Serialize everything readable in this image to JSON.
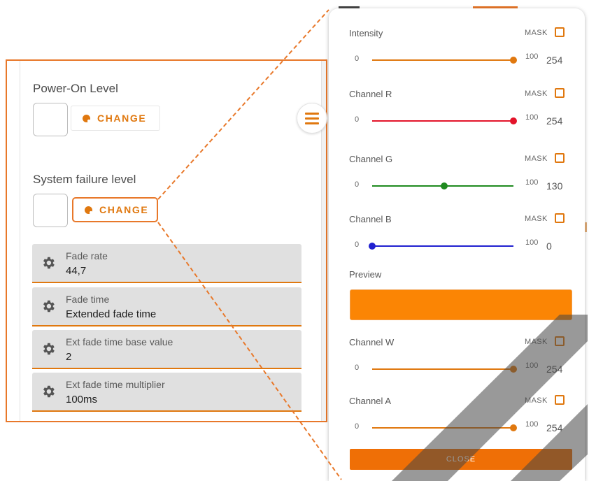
{
  "left_panel": {
    "power_on": {
      "label": "Power-On Level",
      "button": "CHANGE"
    },
    "system_failure": {
      "label": "System failure level",
      "button": "CHANGE"
    },
    "settings": [
      {
        "title": "Fade rate",
        "value": "44,7"
      },
      {
        "title": "Fade time",
        "value": "Extended fade time"
      },
      {
        "title": "Ext fade time base value",
        "value": "2"
      },
      {
        "title": "Ext fade time multiplier",
        "value": "100ms"
      }
    ]
  },
  "dialog": {
    "channels": [
      {
        "label": "Intensity",
        "mask": "MASK",
        "min": "0",
        "max": "100",
        "value": "254",
        "level": 1.0,
        "color": "#e0780f"
      },
      {
        "label": "Channel R",
        "mask": "MASK",
        "min": "0",
        "max": "100",
        "value": "254",
        "level": 1.0,
        "color": "#e3142a"
      },
      {
        "label": "Channel G",
        "mask": "MASK",
        "min": "0",
        "max": "100",
        "value": "130",
        "level": 0.51,
        "color": "#1f8a1f"
      },
      {
        "label": "Channel B",
        "mask": "MASK",
        "min": "0",
        "max": "100",
        "value": "0",
        "level": 0.0,
        "color": "#2020d0"
      }
    ],
    "preview": {
      "label": "Preview",
      "color": "#fb8504"
    },
    "channels_extra": [
      {
        "label": "Channel W",
        "mask": "MASK",
        "min": "0",
        "max": "100",
        "value": "254",
        "level": 1.0,
        "color": "#e0780f"
      },
      {
        "label": "Channel A",
        "mask": "MASK",
        "min": "0",
        "max": "100",
        "value": "254",
        "level": 1.0,
        "color": "#e0780f"
      }
    ],
    "close_label": "CLOSE"
  },
  "theme": {
    "accent": "#e0780f",
    "callout": "#e8782a"
  },
  "icons": [
    "palette-icon",
    "menu-icon",
    "gear-icon"
  ]
}
